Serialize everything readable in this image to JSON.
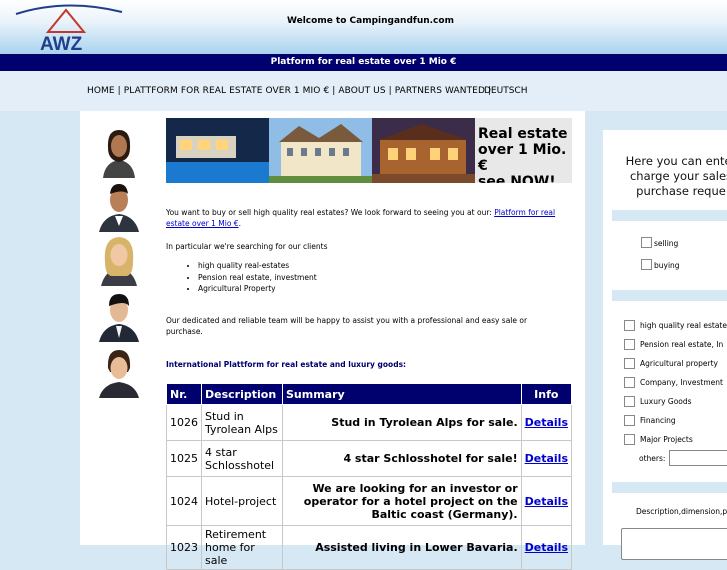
{
  "header": {
    "logo_text": "AWZ",
    "welcome": "Welcome to Campingandfun.com"
  },
  "navbar": {
    "title": "Platform for real estate over 1 Mio €"
  },
  "menu": {
    "items": [
      "HOME",
      "PLATTFORM FOR REAL ESTATE OVER 1 MIO €",
      "ABOUT US",
      "PARTNERS WANTED"
    ],
    "separator": " | ",
    "language": "DEUTSCH"
  },
  "banner": {
    "line1": "Real estate",
    "line2": "over 1 Mio. €",
    "line3": "see NOW!"
  },
  "content": {
    "intro": "You want to buy or sell high quality real estates? We look forward to seeing you at our: ",
    "intro_link": "Platform for real estate over 1 Mio €",
    "intro_end": ".",
    "searching": "In particular we're searching for our clients",
    "bullets": [
      "high quality real-estates",
      "Pension real estate, investment",
      "Agricultural Property"
    ],
    "team": "Our dedicated and reliable team will be happy to assist you with a professional and easy sale or purchase.",
    "section_title": "International Plattform for real estate and luxury goods:"
  },
  "table": {
    "headers": {
      "nr": "Nr.",
      "description": "Description",
      "summary": "Summary",
      "info": "Info"
    },
    "rows": [
      {
        "nr": "1026",
        "description": "Stud in Tyrolean Alps",
        "summary": "Stud in Tyrolean Alps for sale.",
        "link": "Details"
      },
      {
        "nr": "1025",
        "description": "4 star Schlosshotel",
        "summary": "4 star Schlosshotel for sale!",
        "link": "Details"
      },
      {
        "nr": "1024",
        "description": "Hotel-project",
        "summary": "We are looking for an investor or operator for a hotel project on the Baltic coast (Germany).",
        "link": "Details"
      },
      {
        "nr": "1023",
        "description": "Retirement home for sale",
        "summary": "Assisted living in Lower Bavaria.",
        "link": "Details"
      }
    ]
  },
  "right_panel": {
    "intro_lines": [
      "Here you can enter",
      "charge your sales",
      "purchase reque"
    ],
    "mode_options": [
      "selling",
      "buying"
    ],
    "categories": [
      "high quality real estate",
      "Pension real estate, In",
      "Agricultural property",
      "Company, Investment",
      "Luxury Goods",
      "Financing",
      "Major Projects"
    ],
    "others_label": "others:",
    "description_label": "Description,dimension,p"
  },
  "colors": {
    "navy": "#00006e",
    "link": "#0000cc",
    "page_bg": "#d7e8f5"
  }
}
